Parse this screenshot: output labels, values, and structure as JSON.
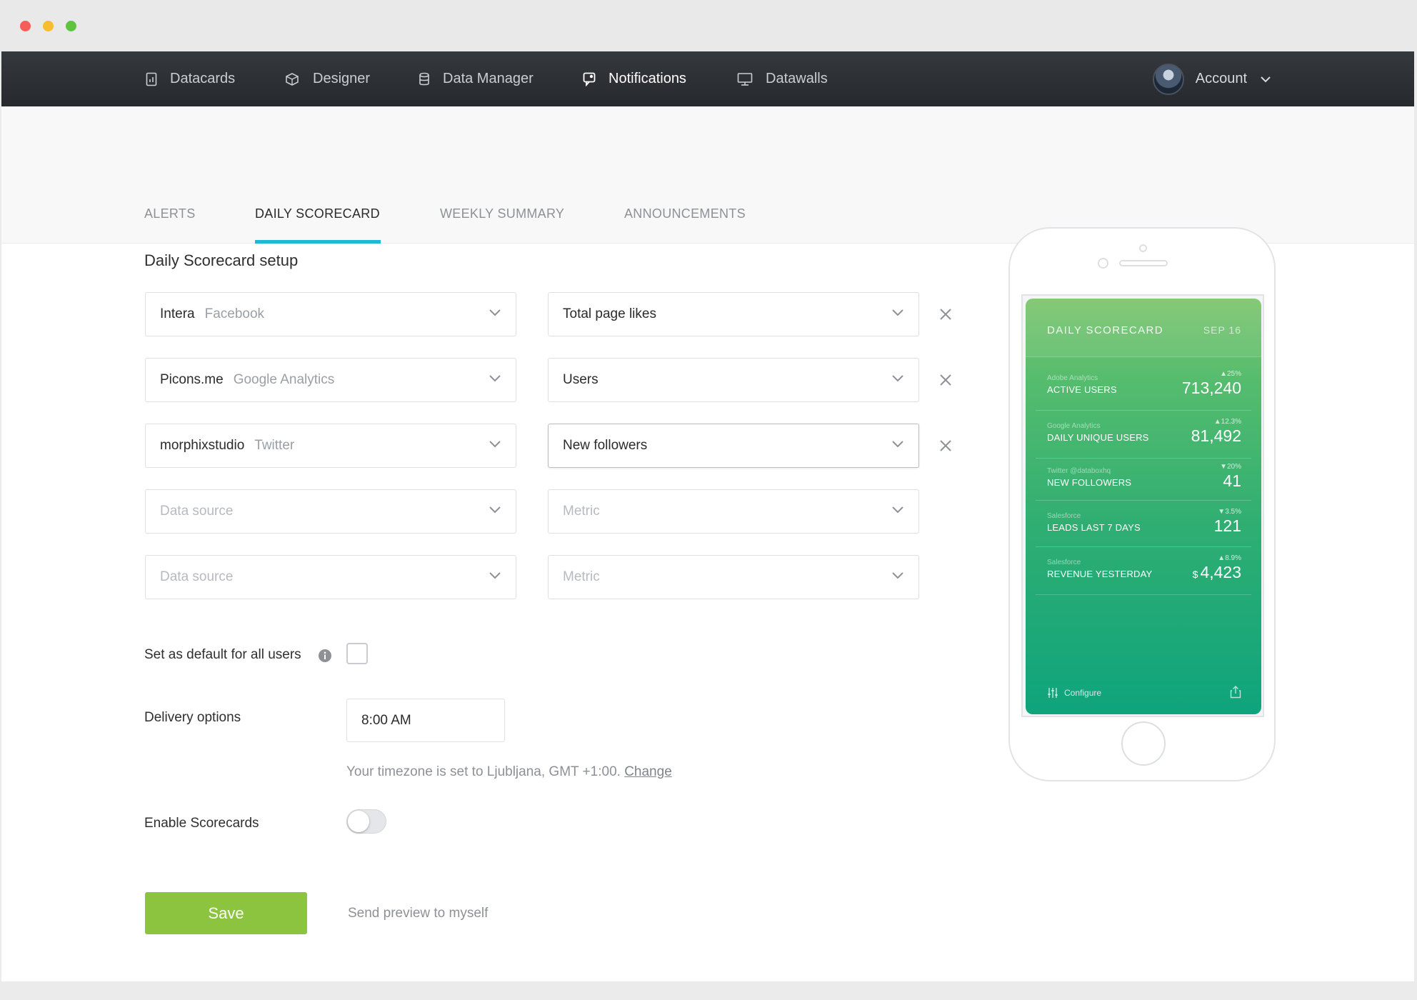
{
  "nav": {
    "items": [
      {
        "label": "Datacards",
        "icon": "datacards-icon"
      },
      {
        "label": "Designer",
        "icon": "designer-icon"
      },
      {
        "label": "Data Manager",
        "icon": "database-icon"
      },
      {
        "label": "Notifications",
        "icon": "notifications-icon"
      },
      {
        "label": "Datawalls",
        "icon": "monitor-icon"
      }
    ],
    "active": "Notifications",
    "account_label": "Account"
  },
  "tabs": [
    {
      "label": "ALERTS"
    },
    {
      "label": "DAILY SCORECARD"
    },
    {
      "label": "WEEKLY SUMMARY"
    },
    {
      "label": "ANNOUNCEMENTS"
    }
  ],
  "active_tab": "DAILY SCORECARD",
  "setup": {
    "title": "Daily Scorecard setup",
    "rows": [
      {
        "source_account": "Intera",
        "source_service": "Facebook",
        "metric": "Total page likes"
      },
      {
        "source_account": "Picons.me",
        "source_service": "Google Analytics",
        "metric": "Users"
      },
      {
        "source_account": "morphixstudio",
        "source_service": "Twitter",
        "metric": "New followers"
      }
    ],
    "source_placeholder": "Data source",
    "metric_placeholder": "Metric"
  },
  "options": {
    "default_label": "Set as default for all users",
    "default_checked": false,
    "delivery_label": "Delivery options",
    "delivery_time": "8:00 AM",
    "timezone_text": "Your timezone is set to Ljubljana, GMT +1:00.",
    "timezone_link": "Change",
    "enable_label": "Enable Scorecards",
    "enable_on": false
  },
  "actions": {
    "save_label": "Save",
    "preview_label": "Send preview to myself"
  },
  "preview": {
    "title": "DAILY SCORECARD",
    "date": "SEP 16",
    "metrics": [
      {
        "source": "Adobe Analytics",
        "name": "ACTIVE USERS",
        "change": "▲25%",
        "value": "713,240",
        "currency": ""
      },
      {
        "source": "Google Analytics",
        "name": "DAILY UNIQUE USERS",
        "change": "▲12.3%",
        "value": "81,492",
        "currency": ""
      },
      {
        "source": "Twitter @databoxhq",
        "name": "NEW FOLLOWERS",
        "change": "▼20%",
        "value": "41",
        "currency": ""
      },
      {
        "source": "Salesforce",
        "name": "LEADS LAST 7 DAYS",
        "change": "▼3.5%",
        "value": "121",
        "currency": ""
      },
      {
        "source": "Salesforce",
        "name": "REVENUE YESTERDAY",
        "change": "▲8.9%",
        "value": "4,423",
        "currency": "$"
      }
    ],
    "configure_label": "Configure"
  },
  "colors": {
    "accent": "#1fb7d6",
    "save_button": "#8cc43f",
    "nav_bg": "#2c3035"
  }
}
